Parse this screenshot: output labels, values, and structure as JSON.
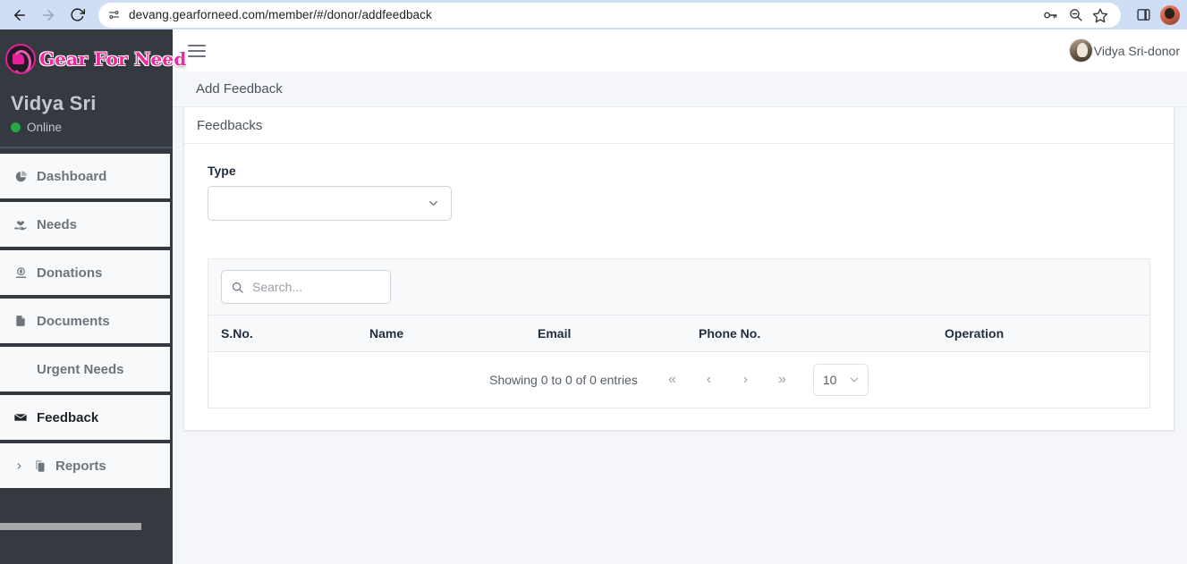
{
  "browser": {
    "url": "devang.gearforneed.com/member/#/donor/addfeedback",
    "back_label": "Back",
    "forward_label": "Forward",
    "reload_label": "Reload",
    "site_info_label": "View site information",
    "password_label": "Passwords",
    "zoom_label": "Zoom",
    "bookmark_label": "Bookmark this tab",
    "side_panel_label": "Side panel",
    "profile_label": "Profile"
  },
  "sidebar": {
    "brand": "Gear For Need",
    "user_name": "Vidya Sri",
    "status": "Online",
    "items": [
      {
        "label": "Dashboard",
        "icon": "pie-chart-icon",
        "active": false
      },
      {
        "label": "Needs",
        "icon": "hand-heart-icon",
        "active": false
      },
      {
        "label": "Donations",
        "icon": "money-icon",
        "active": false
      },
      {
        "label": "Documents",
        "icon": "file-icon",
        "active": false
      },
      {
        "label": "Urgent Needs",
        "icon": "",
        "active": false
      },
      {
        "label": "Feedback",
        "icon": "envelope-icon",
        "active": true
      },
      {
        "label": "Reports",
        "icon": "copy-icon",
        "active": false
      }
    ]
  },
  "topbar": {
    "menu_toggle_label": "Toggle navigation",
    "username": "Vidya Sri-donor"
  },
  "breadcrumb": {
    "title": "Add Feedback"
  },
  "card": {
    "header": "Feedbacks",
    "type_label": "Type",
    "type_value": "",
    "type_placeholder": ""
  },
  "table": {
    "search_placeholder": "Search...",
    "search_value": "",
    "columns": [
      "S.No.",
      "Name",
      "Email",
      "Phone No.",
      "Operation"
    ],
    "rows": [],
    "entries_info": "Showing 0 to 0 of 0 entries",
    "pagination": {
      "first": "«",
      "prev": "‹",
      "next": "›",
      "last": "»"
    },
    "page_size": "10"
  },
  "colors": {
    "sidebar_bg": "#343a40",
    "brand_pink": "#ef2a9c",
    "status_green": "#28a745",
    "page_bg": "#f4f6f9",
    "browser_bar": "#cfddf5"
  }
}
